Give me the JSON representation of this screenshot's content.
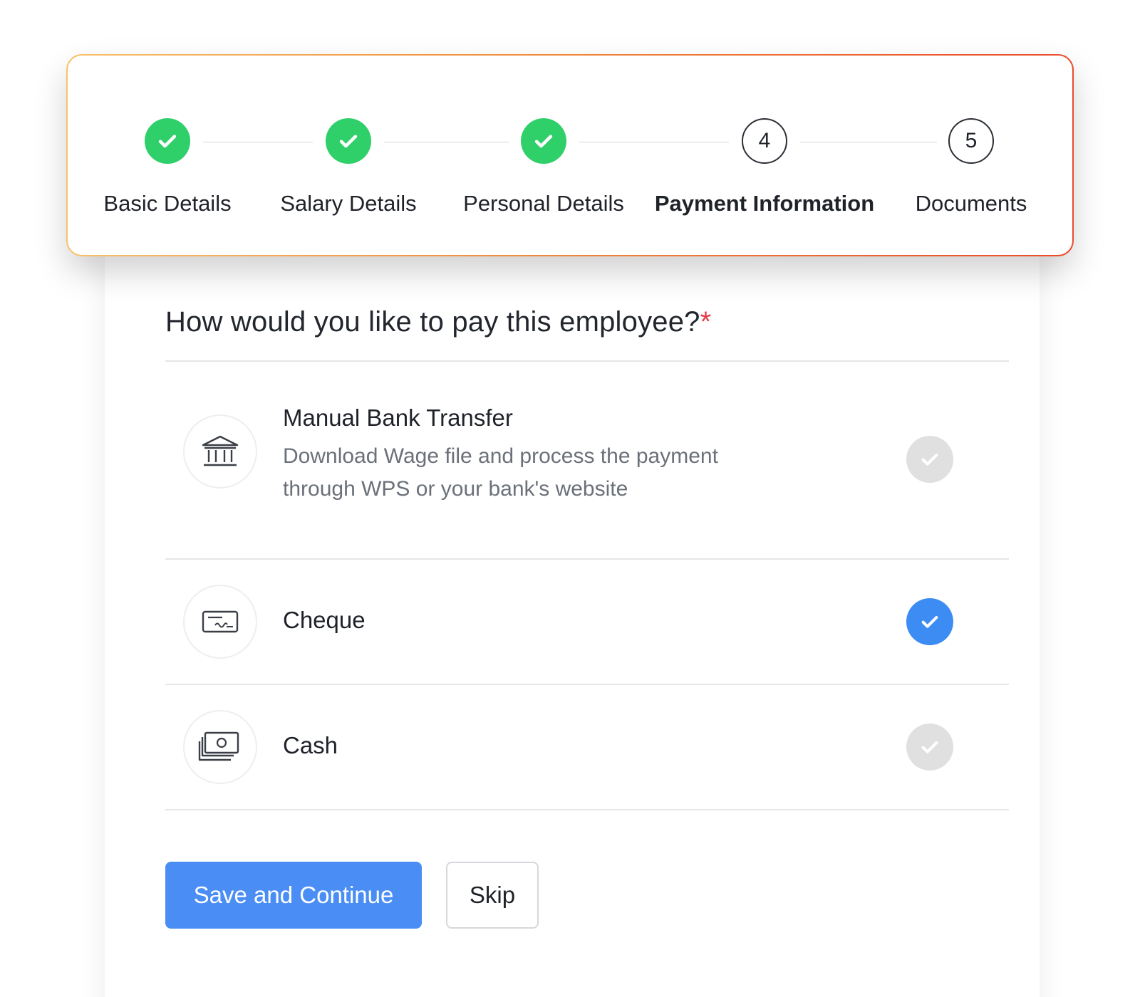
{
  "stepper": {
    "steps": [
      {
        "label": "Basic Details",
        "status": "done",
        "number": "1"
      },
      {
        "label": "Salary Details",
        "status": "done",
        "number": "2"
      },
      {
        "label": "Personal Details",
        "status": "done",
        "number": "3"
      },
      {
        "label": "Payment Information",
        "status": "current",
        "number": "4"
      },
      {
        "label": "Documents",
        "status": "todo",
        "number": "5"
      }
    ],
    "colors": {
      "done": "#2fcf6a",
      "border_gradient": [
        "#f7c16b",
        "#f08c3a",
        "#ea4b2c"
      ]
    }
  },
  "question": {
    "text": "How would you like to pay this employee?",
    "required_mark": "*"
  },
  "options": [
    {
      "icon": "bank-icon",
      "title": "Manual Bank Transfer",
      "description_line1": "Download Wage file and process the payment",
      "description_line2": "through WPS or your bank's  website",
      "selected": false
    },
    {
      "icon": "cheque-icon",
      "title": "Cheque",
      "selected": true
    },
    {
      "icon": "cash-icon",
      "title": "Cash",
      "selected": false
    }
  ],
  "actions": {
    "save_label": "Save and Continue",
    "skip_label": "Skip"
  },
  "colors": {
    "primary": "#4a8ef5",
    "selected_check": "#3d8cf4",
    "unselected_check": "#e0e0e0",
    "required": "#e53945"
  }
}
